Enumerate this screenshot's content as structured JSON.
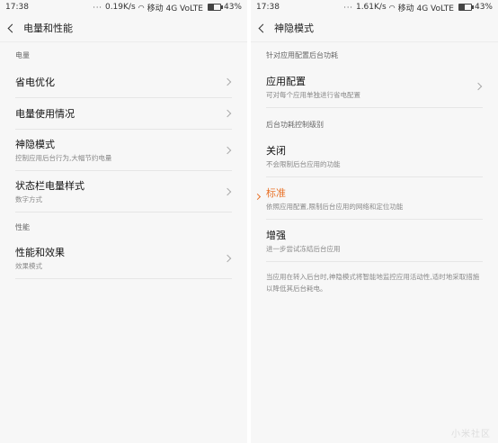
{
  "left": {
    "status": {
      "time": "17:38",
      "speed": "0.19K/s",
      "carrier": "移动 4G VoLTE",
      "battery": "43%",
      "battery_level": 0.43
    },
    "header_title": "电量和性能",
    "sec_power": "电量",
    "items_power": [
      {
        "title": "省电优化",
        "sub": ""
      },
      {
        "title": "电量使用情况",
        "sub": ""
      },
      {
        "title": "神隐模式",
        "sub": "控制应用后台行为,大幅节约电量"
      },
      {
        "title": "状态栏电量样式",
        "sub": "数字方式"
      }
    ],
    "sec_perf": "性能",
    "items_perf": [
      {
        "title": "性能和效果",
        "sub": "效果模式"
      }
    ]
  },
  "right": {
    "status": {
      "time": "17:38",
      "speed": "1.61K/s",
      "carrier": "移动 4G VoLTE",
      "battery": "43%",
      "battery_level": 0.43
    },
    "header_title": "神隐模式",
    "sec_config": "针对应用配置后台功耗",
    "app_config": {
      "title": "应用配置",
      "sub": "可对每个应用单独进行省电配置"
    },
    "sec_level": "后台功耗控制级别",
    "options": [
      {
        "title": "关闭",
        "sub": "不会限制后台应用的功能",
        "selected": false
      },
      {
        "title": "标准",
        "sub": "依照应用配置,限制后台应用的网络和定位功能",
        "selected": true
      },
      {
        "title": "增强",
        "sub": "进一步尝试冻结后台应用",
        "selected": false
      }
    ],
    "note": "当应用在转入后台时,神隐模式将智能地监控应用活动性,适时地采取措施以降低其后台耗电。"
  },
  "watermark": "小米社区",
  "colors": {
    "accent": "#e8732a",
    "background": "#f7f7f7",
    "divider": "#e6e6e6"
  }
}
